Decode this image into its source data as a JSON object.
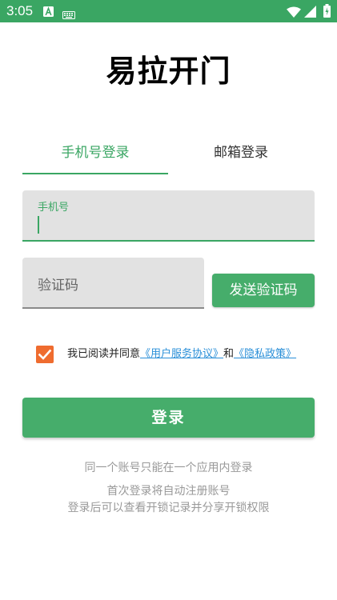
{
  "status_bar": {
    "time": "3:05"
  },
  "app": {
    "title": "易拉开门"
  },
  "tabs": [
    {
      "label": "手机号登录",
      "active": true
    },
    {
      "label": "邮箱登录",
      "active": false
    }
  ],
  "phone_field": {
    "label": "手机号",
    "value": ""
  },
  "code_field": {
    "placeholder": "验证码",
    "value": ""
  },
  "send_code_button": {
    "label": "发送验证码"
  },
  "agreement": {
    "checked": true,
    "prefix": "我已阅读并同意",
    "terms_link": "《用户服务协议》",
    "conjunction": "和",
    "privacy_link": "《隐私政策》"
  },
  "login_button": {
    "label": "登录"
  },
  "hints": {
    "line1": "同一个账号只能在一个应用内登录",
    "line2": "首次登录将自动注册账号",
    "line3": "登录后可以查看开锁记录并分享开锁权限"
  },
  "colors": {
    "accent": "#3aa663",
    "button": "#46ad6b",
    "checkbox": "#ef6c2f",
    "link": "#2a8fd8"
  }
}
